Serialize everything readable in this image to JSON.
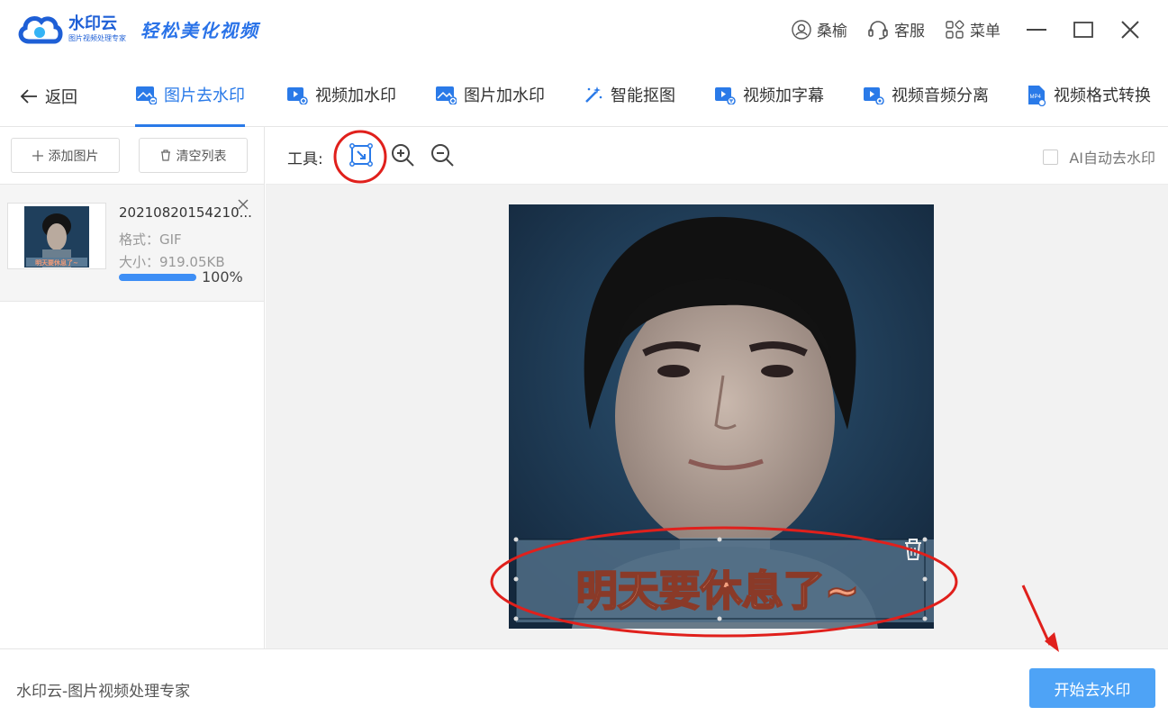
{
  "app": {
    "brand_name": "水印云",
    "brand_sub": "图片视频处理专家",
    "slogan": "轻松美化视频"
  },
  "titlebar": {
    "user_label": "桑榆",
    "service_label": "客服",
    "menu_label": "菜单"
  },
  "nav": {
    "back_label": "返回",
    "tabs": [
      {
        "label": "图片去水印",
        "icon": "image-remove-icon",
        "active": true
      },
      {
        "label": "视频加水印",
        "icon": "video-add-icon",
        "active": false
      },
      {
        "label": "图片加水印",
        "icon": "image-add-icon",
        "active": false
      },
      {
        "label": "智能抠图",
        "icon": "magic-wand-icon",
        "active": false
      },
      {
        "label": "视频加字幕",
        "icon": "video-subtitle-icon",
        "active": false
      },
      {
        "label": "视频音频分离",
        "icon": "video-audio-split-icon",
        "active": false
      },
      {
        "label": "视频格式转换",
        "icon": "mp4-convert-icon",
        "active": false
      }
    ]
  },
  "sidebar": {
    "add_label": "添加图片",
    "clear_label": "清空列表",
    "files": [
      {
        "name": "20210820154210...",
        "format": "格式：GIF",
        "size": "大小：919.05KB",
        "progress_label": "100%",
        "progress": 1.0
      }
    ]
  },
  "toolbar": {
    "tools_label": "工具:",
    "ai_label": "AI自动去水印",
    "ai_checked": false
  },
  "canvas": {
    "subtitle_text": "明天要休息了~"
  },
  "footer": {
    "brand_text": "水印云-图片视频处理专家",
    "start_label": "开始去水印"
  },
  "colors": {
    "accent": "#2a7ae8",
    "start_button": "#4ea3f6",
    "annotation_red": "#e0201c"
  }
}
